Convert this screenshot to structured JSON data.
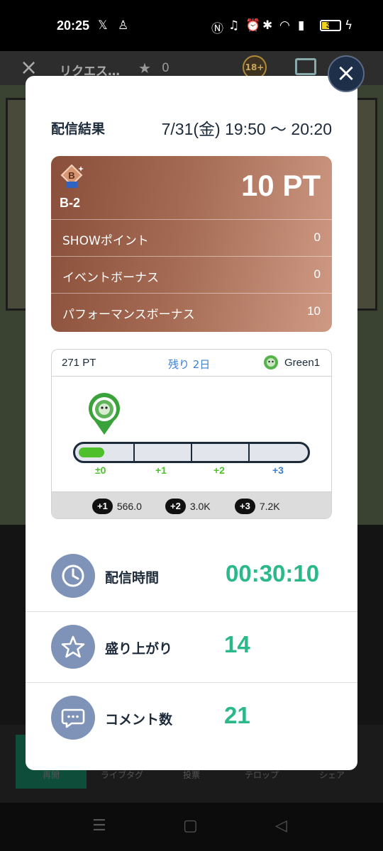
{
  "status_bar": {
    "time": "20:25",
    "battery": "37"
  },
  "background": {
    "title": "リクエス…",
    "star_count": "0",
    "age_badge": "18+",
    "nav_labels": [
      "再開",
      "ライブタグ",
      "投票",
      "テロップ",
      "シェア"
    ]
  },
  "modal": {
    "title": "配信結果",
    "time_range": "7/31(金) 19:50 〜 20:20",
    "rank": {
      "badge_letter": "B",
      "label": "B-2",
      "points": "10 PT",
      "color": "#a46a53",
      "rows": [
        {
          "label": "SHOWポイント",
          "value": "0"
        },
        {
          "label": "イベントボーナス",
          "value": "0"
        },
        {
          "label": "パフォーマンスボーナス",
          "value": "10"
        }
      ]
    },
    "progress": {
      "current": "271 PT",
      "remaining": "残り 2日",
      "user": "Green1",
      "fill_fraction": 0.1,
      "ticks": [
        "±0",
        "+1",
        "+2",
        "+3"
      ],
      "tick_colors": [
        "#4ec12a",
        "#4ec12a",
        "#4ec12a",
        "#3d7fd1"
      ],
      "requirements": [
        {
          "step": "+1",
          "value": "566.0"
        },
        {
          "step": "+2",
          "value": "3.0K"
        },
        {
          "step": "+3",
          "value": "7.2K"
        }
      ]
    },
    "stats": [
      {
        "icon": "clock-icon",
        "label": "配信時間",
        "value": "00:30:10"
      },
      {
        "icon": "star-icon",
        "label": "盛り上がり",
        "value": "14"
      },
      {
        "icon": "comment-icon",
        "label": "コメント数",
        "value": "21"
      }
    ],
    "accent_color": "#2bb88a"
  }
}
